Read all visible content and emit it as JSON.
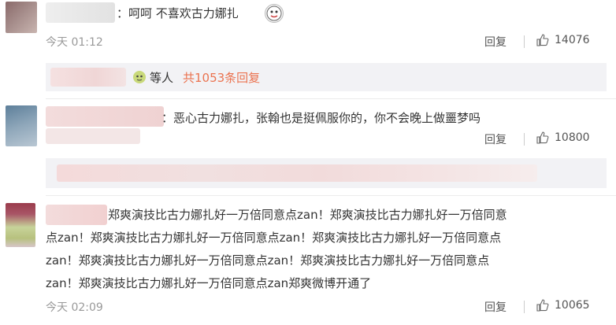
{
  "comments": [
    {
      "text": "：呵呵 不喜欢古力娜扎",
      "time": "今天 01:12",
      "reply_label": "回复",
      "likes": "14076",
      "sub": {
        "text": "等人",
        "count": "共1053条回复"
      }
    },
    {
      "text": "：恶心古力娜扎，张翰也是挺佩服你的，你不会晚上做噩梦吗",
      "reply_label": "回复",
      "likes": "10800"
    },
    {
      "lines": [
        "郑爽演技比古力娜扎好一万倍同意点zan！郑爽演技比古力娜扎好一万倍同意",
        "点zan！郑爽演技比古力娜扎好一万倍同意点zan！郑爽演技比古力娜扎好一万倍同意点",
        "zan！郑爽演技比古力娜扎好一万倍同意点zan！郑爽演技比古力娜扎好一万倍同意点",
        "zan！郑爽演技比古力娜扎好一万倍同意点zan郑爽微博开通了"
      ],
      "time": "今天 02:09",
      "reply_label": "回复",
      "likes": "10065"
    }
  ],
  "colors": {
    "link": "#eb7350",
    "text": "#333333",
    "meta": "#999999"
  }
}
